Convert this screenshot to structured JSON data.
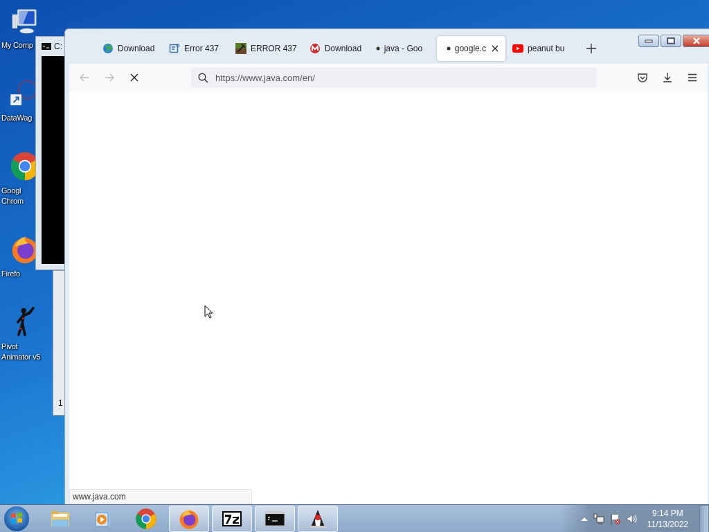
{
  "desktop_icons": [
    {
      "kind": "computer",
      "lines": [
        "My Comp"
      ]
    },
    {
      "kind": "network",
      "lines": [
        "DataWag"
      ]
    },
    {
      "kind": "chrome",
      "lines": [
        "Googl",
        "Chrom"
      ]
    },
    {
      "kind": "firefox",
      "lines": [
        "Firefo"
      ]
    },
    {
      "kind": "stickman",
      "lines": [
        "Pivot",
        "Animator v5"
      ]
    }
  ],
  "console_window": {
    "title": "C:"
  },
  "back_window": {
    "text": "1"
  },
  "browser": {
    "tabs": [
      {
        "kind": "globe",
        "label": "Download",
        "selected": false
      },
      {
        "kind": "doc",
        "label": "Error 437",
        "selected": false
      },
      {
        "kind": "block",
        "label": "ERROR 437",
        "selected": false
      },
      {
        "kind": "mega",
        "label": "Download",
        "selected": false
      },
      {
        "kind": "dot",
        "label": "java - Goo",
        "selected": false
      },
      {
        "kind": "dot",
        "label": "google.c",
        "selected": true
      },
      {
        "kind": "youtube",
        "label": "peanut bu",
        "selected": false
      }
    ],
    "nav": [
      {
        "kind": "back",
        "disabled": true
      },
      {
        "kind": "forward",
        "disabled": true
      },
      {
        "kind": "stop",
        "disabled": false
      }
    ],
    "url": "https://www.java.com/en/",
    "status": "www.java.com"
  },
  "taskbar": {
    "apps": [
      {
        "kind": "explorer",
        "running": false
      },
      {
        "kind": "media",
        "running": false
      },
      {
        "kind": "chrome",
        "running": false
      },
      {
        "kind": "firefox",
        "running": true
      },
      {
        "kind": "sevenzip",
        "running": true
      },
      {
        "kind": "cmd",
        "running": true
      },
      {
        "kind": "java",
        "running": true
      }
    ],
    "time": "9:14 PM",
    "date": "11/13/2022"
  }
}
